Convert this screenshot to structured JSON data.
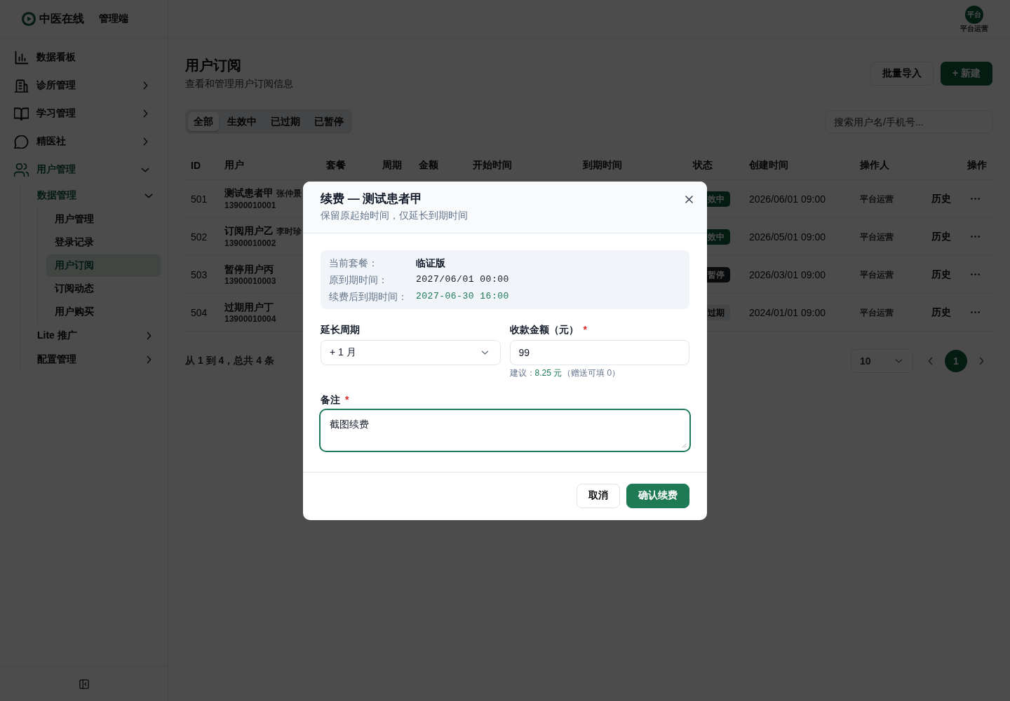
{
  "app": {
    "name": "中医在线",
    "subtitle": "管理端"
  },
  "user": {
    "avatar_text": "平台",
    "name": "平台运营"
  },
  "sidebar": {
    "items": [
      {
        "label": "数据看板",
        "selected": false
      },
      {
        "label": "诊所管理",
        "selected": false,
        "expanded": false
      },
      {
        "label": "学习管理",
        "selected": false,
        "expanded": false
      },
      {
        "label": "精医社",
        "selected": false,
        "expanded": false
      },
      {
        "label": "用户管理",
        "selected": true,
        "expanded": true,
        "children": [
          {
            "label": "数据管理",
            "selected": true,
            "expanded": true,
            "children": [
              {
                "label": "用户管理",
                "selected": false
              },
              {
                "label": "登录记录",
                "selected": false
              },
              {
                "label": "用户订阅",
                "selected": true
              },
              {
                "label": "订阅动态",
                "selected": false
              },
              {
                "label": "用户购买",
                "selected": false
              }
            ]
          },
          {
            "label": "Lite 推广",
            "selected": false,
            "expanded": false
          },
          {
            "label": "配置管理",
            "selected": false,
            "expanded": false
          }
        ]
      }
    ]
  },
  "page": {
    "title": "用户订阅",
    "subtitle": "查看和管理用户订阅信息",
    "actions": [
      {
        "label": "批量导入",
        "kind": "secondary"
      },
      {
        "label": "+ 新建",
        "kind": "primary"
      }
    ]
  },
  "filters": {
    "tabs": [
      {
        "label": "全部",
        "selected": true
      },
      {
        "label": "生效中",
        "selected": false
      },
      {
        "label": "已过期",
        "selected": false
      },
      {
        "label": "已暂停",
        "selected": false
      }
    ],
    "search": {
      "placeholder": "搜索用户名/手机号..."
    }
  },
  "table": {
    "columns": [
      "ID",
      "用户",
      "套餐",
      "周期",
      "金额",
      "开始时间",
      "到期时间",
      "状态",
      "创建时间",
      "操作人",
      "操作"
    ],
    "rows": [
      {
        "id": "501",
        "name": "测试患者甲",
        "alias": "张仲景",
        "phone": "13900010001",
        "status": {
          "label": "效中",
          "kind": "active"
        },
        "created": "2026/06/01 09:00",
        "operator": "平台运营",
        "action": "历史"
      },
      {
        "id": "502",
        "name": "订阅用户乙",
        "alias": "李时珍",
        "phone": "13900010002",
        "status": {
          "label": "效中",
          "kind": "active"
        },
        "created": "2026/05/01 09:00",
        "operator": "平台运营",
        "action": "历史"
      },
      {
        "id": "503",
        "name": "暂停用户丙",
        "phone": "13900010003",
        "status": {
          "label": "暂停",
          "kind": "paused"
        },
        "created": "2026/03/01 09:00",
        "operator": "平台运营",
        "action": "历史"
      },
      {
        "id": "504",
        "name": "过期用户丁",
        "phone": "13900010004",
        "status": {
          "label": "过期",
          "kind": "expired"
        },
        "created": "2024/01/01 09:00",
        "operator": "平台运营",
        "action": "历史"
      }
    ]
  },
  "pagination": {
    "summary": "从 1 到 4，总共 4 条",
    "page_size": "10",
    "pages": [
      {
        "label": "1",
        "selected": true
      }
    ]
  },
  "dialog": {
    "title": "续费 — 测试患者甲",
    "subtitle": "保留原起始时间，仅延长到期时间",
    "info": [
      {
        "label": "当前套餐：",
        "value": "临证版",
        "kind": "plan"
      },
      {
        "label": "原到期时间：",
        "value": "2027/06/01 00:00",
        "kind": "date"
      },
      {
        "label": "续费后到期时间：",
        "value": "2027-06-30 16:00",
        "kind": "new_date"
      }
    ],
    "fields": [
      {
        "kind": "select",
        "label": "延长周期",
        "value": "+ 1 月"
      },
      {
        "kind": "input",
        "label": "收款金额（元）",
        "required_mark": "*",
        "value": "99",
        "hint": {
          "text": "建议：",
          "amount": "8.25 元",
          "note": "（赠送可填 0）"
        }
      },
      {
        "kind": "textarea",
        "label": "备注",
        "required_mark": "*",
        "value": "截图续费",
        "focused": true
      }
    ],
    "buttons": [
      {
        "label": "取消",
        "kind": "secondary"
      },
      {
        "label": "确认续费",
        "kind": "primary"
      }
    ]
  }
}
